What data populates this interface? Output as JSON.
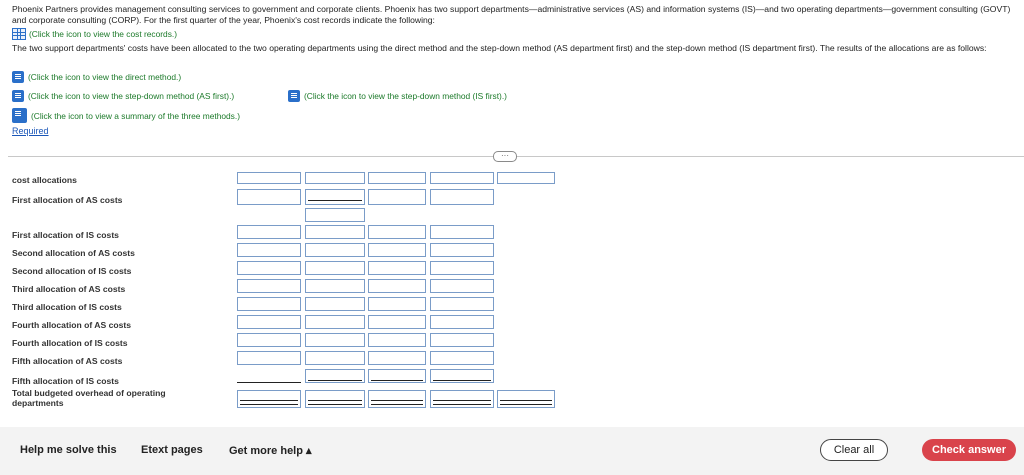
{
  "intro": {
    "para1": "Phoenix Partners provides management consulting services to government and corporate clients. Phoenix has two support departments—administrative services (AS) and information systems (IS)—and two operating departments—government consulting (GOVT) and corporate consulting (CORP). For the first quarter of the year, Phoenix's cost records indicate the following:",
    "cost_records_link": "(Click the icon to view the cost records.)",
    "para2": "The two support departments' costs have been allocated to the two operating departments using the direct method and the step-down method (AS department first) and the step-down method (IS department first). The results of the allocations are as follows:"
  },
  "links": {
    "direct": "(Click the icon to view the direct method.)",
    "stepdown_as": "(Click the icon to view the step-down method (AS first).)",
    "stepdown_is": "(Click the icon to view the step-down method (IS first).)",
    "summary": "(Click the icon to view a summary of the three methods.)",
    "required": "Required"
  },
  "table": {
    "rows": {
      "cost_allocations": "cost allocations",
      "first_as": "First allocation of AS costs",
      "first_is": "First allocation of IS costs",
      "second_as": "Second allocation of AS costs",
      "second_is": "Second allocation of IS costs",
      "third_as": "Third allocation of AS costs",
      "third_is": "Third allocation of IS costs",
      "fourth_as": "Fourth allocation of AS costs",
      "fourth_is": "Fourth allocation of IS costs",
      "fifth_as": "Fifth allocation of AS costs",
      "fifth_is": "Fifth allocation of IS costs",
      "total_line1": "Total budgeted overhead of operating",
      "total_line2": "departments"
    }
  },
  "footer": {
    "help": "Help me solve this",
    "etext": "Etext pages",
    "more_help": "Get more help ▴",
    "clear": "Clear all",
    "check": "Check answer"
  },
  "colors": {
    "accent_red": "#d9434b",
    "link_green": "#1c7a2a",
    "link_blue": "#1a56b8",
    "input_border": "#7a9cc8"
  }
}
